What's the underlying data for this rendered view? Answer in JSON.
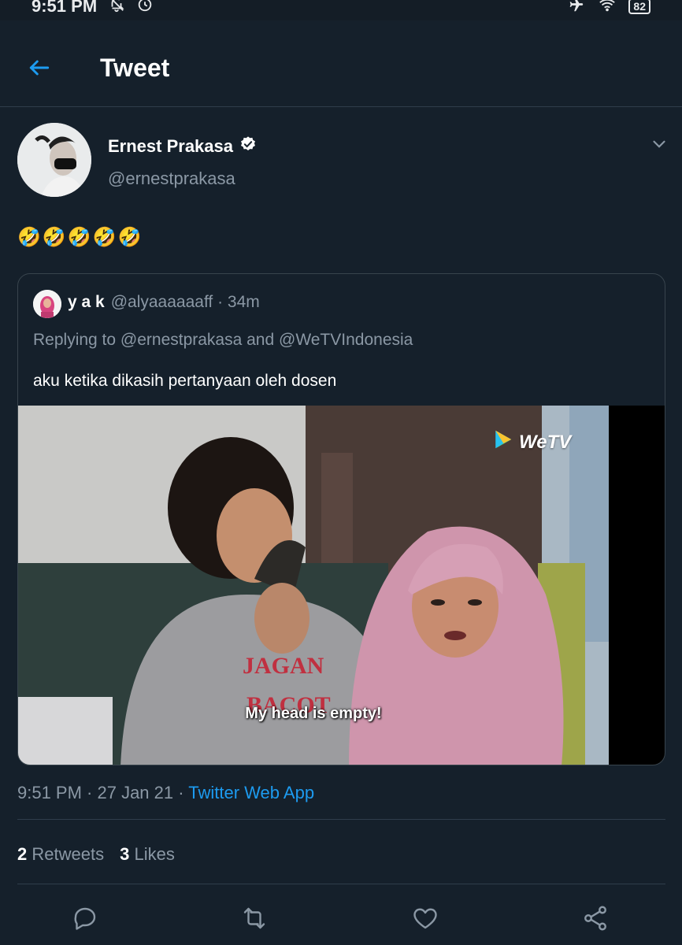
{
  "status_bar": {
    "time": "9:51 PM",
    "left_icons": [
      "mute-icon",
      "alarm-icon"
    ],
    "right_icons": [
      "airplane-icon",
      "wifi-icon",
      "battery-icon"
    ],
    "battery_level": "82"
  },
  "header": {
    "back_icon": "arrow-left-icon",
    "title": "Tweet"
  },
  "tweet": {
    "author_name": "Ernest Prakasa",
    "verified_icon": "verified-badge-icon",
    "author_handle": "@ernestprakasa",
    "text": "🤣🤣🤣🤣🤣",
    "menu_icon": "chevron-down-icon",
    "timestamp": "9:51 PM · 27 Jan 21 · ",
    "source": "Twitter Web App",
    "retweets_count": "2",
    "retweets_label": "Retweets",
    "likes_count": "3",
    "likes_label": "Likes"
  },
  "quoted_tweet": {
    "name": "y a k",
    "handle_time": "@alyaaaaaaff · 34m",
    "replying_to": "Replying to @ernestprakasa and @WeTVIndonesia",
    "text": "aku ketika dikasih pertanyaan oleh dosen",
    "media": {
      "watermark": "WeTV",
      "subtitle": "My head is empty!"
    }
  },
  "actions": [
    "reply-icon",
    "retweet-icon",
    "like-icon",
    "share-icon"
  ],
  "colors": {
    "background": "#15202b",
    "accent": "#1d9bf0",
    "secondary_text": "#8b98a5",
    "border": "#38444d"
  }
}
